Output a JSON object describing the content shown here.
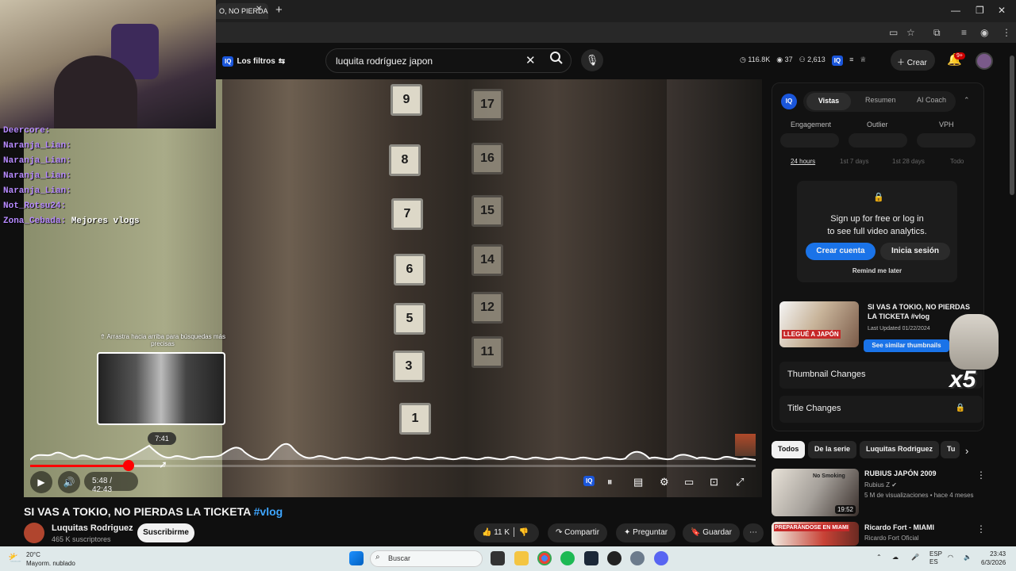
{
  "browser": {
    "tab_title": "O, NO PIERDA",
    "tab_close": "✕",
    "new_tab": "+",
    "window_controls": [
      "—",
      "❐",
      "✕"
    ]
  },
  "youtube": {
    "filters_label": "Los filtros",
    "iq_badge": "IQ",
    "search_value": "luquita rodríguez japon",
    "header_stats": [
      "116.8K",
      "37",
      "2,613"
    ],
    "create_label": "Crear",
    "notif_count": "9+"
  },
  "chat": [
    {
      "user": "Deercore:",
      "msg": ""
    },
    {
      "user": "Naranja_Lian:",
      "msg": ""
    },
    {
      "user": "Naranja_Lian:",
      "msg": ""
    },
    {
      "user": "Naranja_Lian:",
      "msg": ""
    },
    {
      "user": "Naranja_Lian:",
      "msg": ""
    },
    {
      "user": "Not_Rotsu24:",
      "msg": ""
    },
    {
      "user": "Zona_Cebada:",
      "msg": "Mejores vlogs"
    }
  ],
  "player": {
    "floor_numbers_left": [
      "9",
      "8",
      "7",
      "6",
      "5",
      "3",
      "1"
    ],
    "floor_numbers_mid": [
      "17",
      "16",
      "15",
      "14",
      "12",
      "11"
    ],
    "drag_hint": "⇮ Arrastra hacia arriba para búsquedas más precisas",
    "hover_time": "7:41",
    "time_display": "5:48 / 42:43",
    "progress_fraction": 0.136,
    "buffer_fraction": 0.186
  },
  "video": {
    "title": "SI VAS A TOKIO, NO PIERDAS LA TICKETA",
    "hashtag": "#vlog",
    "channel": "Luquitas Rodriguez",
    "subscribers": "465 K suscriptores",
    "subscribe_label": "Suscribirme",
    "likes": "11 K",
    "share_label": "Compartir",
    "ask_label": "Preguntar",
    "save_label": "Guardar"
  },
  "vidiq": {
    "logo": "IQ",
    "tabs": [
      "Vistas",
      "Resumen",
      "AI Coach"
    ],
    "metrics": [
      "Engagement",
      "Outlier",
      "VPH"
    ],
    "ranges": [
      "24 hours",
      "1st 7 days",
      "1st 28 days",
      "Todo"
    ],
    "lock_line1": "Sign up for free or log in",
    "lock_line2": "to see full video analytics.",
    "create_account": "Crear cuenta",
    "login": "Inicia sesión",
    "remind": "Remind me later",
    "thumb_title": "SI VAS A TOKIO, NO PIERDAS LA TICKETA #vlog",
    "thumb_overlay": "LLEGUÉ A JAPÓN",
    "last_updated": "Last Updated 01/22/2024",
    "similar_btn": "See similar thumbnails",
    "thumbnail_changes": "Thumbnail Changes",
    "title_changes": "Title Changes",
    "overlay_text": "x5"
  },
  "chips": [
    "Todos",
    "De la serie",
    "Luquitas Rodriguez",
    "Tu"
  ],
  "recommendations": [
    {
      "title": "RUBIUS JAPÓN 2009",
      "channel": "Rubius Z",
      "meta": "5 M de visualizaciones • hace 4 meses",
      "duration": "19:52",
      "thumb_text": "No Smoking"
    },
    {
      "title": "Ricardo Fort - MIAMI",
      "channel": "Ricardo Fort Oficial",
      "meta": "",
      "duration": "",
      "thumb_text": "PREPARÁNDOSE EN MIAMI"
    }
  ],
  "taskbar": {
    "temp": "20°C",
    "weather": "Mayorm. nublado",
    "search": "Buscar",
    "lang1": "ESP",
    "lang2": "ES",
    "time": "23:43",
    "date": "6/3/2026"
  },
  "colors": {
    "accent_blue": "#1a73e8",
    "progress_red": "#ff0000",
    "link_blue": "#3ea6ff"
  }
}
